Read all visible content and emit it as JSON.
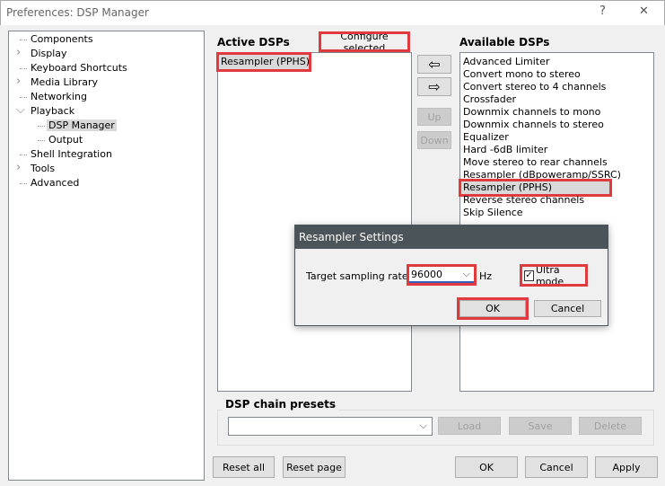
{
  "window": {
    "title": "Preferences: DSP Manager",
    "help": "?",
    "close": "✕"
  },
  "tree": [
    {
      "label": "Components",
      "expander": "none",
      "indent": 0
    },
    {
      "label": "Display",
      "expander": "collapsed",
      "indent": 0
    },
    {
      "label": "Keyboard Shortcuts",
      "expander": "none",
      "indent": 0
    },
    {
      "label": "Media Library",
      "expander": "collapsed",
      "indent": 0
    },
    {
      "label": "Networking",
      "expander": "none",
      "indent": 0
    },
    {
      "label": "Playback",
      "expander": "expanded",
      "indent": 0
    },
    {
      "label": "DSP Manager",
      "expander": "none",
      "indent": 1,
      "selected": true
    },
    {
      "label": "Output",
      "expander": "none",
      "indent": 1
    },
    {
      "label": "Shell Integration",
      "expander": "none",
      "indent": 0
    },
    {
      "label": "Tools",
      "expander": "collapsed",
      "indent": 0
    },
    {
      "label": "Advanced",
      "expander": "none",
      "indent": 0
    }
  ],
  "active": {
    "title": "Active DSPs",
    "configure": "Configure selected",
    "items": [
      "Resampler (PPHS)"
    ]
  },
  "middle": {
    "add_icon": "arrow-left-icon",
    "remove_icon": "arrow-right-icon",
    "up": "Up",
    "down": "Down"
  },
  "available": {
    "title": "Available DSPs",
    "items": [
      "Advanced Limiter",
      "Convert mono to stereo",
      "Convert stereo to 4 channels",
      "Crossfader",
      "Downmix channels to mono",
      "Downmix channels to stereo",
      "Equalizer",
      "Hard -6dB limiter",
      "Move stereo to rear channels",
      "Resampler (dBpoweramp/SSRC)",
      "Resampler (PPHS)",
      "Reverse stereo channels",
      "Skip Silence"
    ],
    "selected": "Resampler (PPHS)"
  },
  "presets": {
    "title": "DSP chain presets",
    "value": "",
    "load": "Load",
    "save": "Save",
    "delete": "Delete"
  },
  "footer": {
    "reset_all": "Reset all",
    "reset_page": "Reset page",
    "ok": "OK",
    "cancel": "Cancel",
    "apply": "Apply"
  },
  "dialog": {
    "title": "Resampler Settings",
    "rate_label": "Target sampling rate:",
    "rate_value": "96000",
    "unit": "Hz",
    "ultra_label": "Ultra mode",
    "ultra_checked": true,
    "ok": "OK",
    "cancel": "Cancel"
  },
  "colors": {
    "highlight": "#e0393e",
    "dialog_title": "#4a5459"
  }
}
